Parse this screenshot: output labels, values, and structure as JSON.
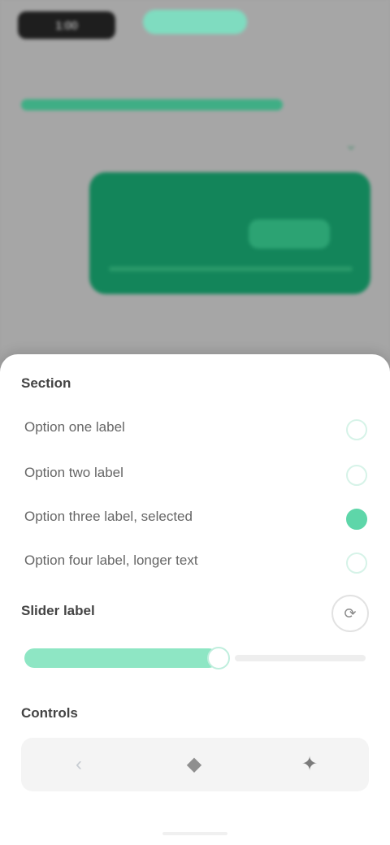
{
  "background": {
    "top_left_label": "1:00",
    "top_center_label": "",
    "top_right_label": "",
    "sub_right_label": "",
    "strip_text": "",
    "card_items": [
      "",
      "",
      ""
    ],
    "left_small_label": "",
    "tail_icon": "chevron-down-icon"
  },
  "sheet": {
    "section1_title": "Section",
    "options": [
      {
        "label": "Option one label",
        "selected": false
      },
      {
        "label": "Option two label",
        "selected": false
      },
      {
        "label": "Option three label, selected",
        "selected": true
      },
      {
        "label": "Option four label, longer text",
        "selected": false
      }
    ],
    "section2_title": "Slider label",
    "slider_value_fraction": 0.57,
    "icon_button_icon": "refresh-icon",
    "section3_title": "Controls",
    "segments": [
      {
        "icon": "left-icon",
        "glyph": "‹"
      },
      {
        "icon": "pin-icon",
        "glyph": "◆"
      },
      {
        "icon": "star-icon",
        "glyph": "✦"
      }
    ]
  },
  "colors": {
    "accent": "#13855a",
    "accent_light": "#8ee6c4",
    "selected_radio": "#5ed6a9"
  }
}
